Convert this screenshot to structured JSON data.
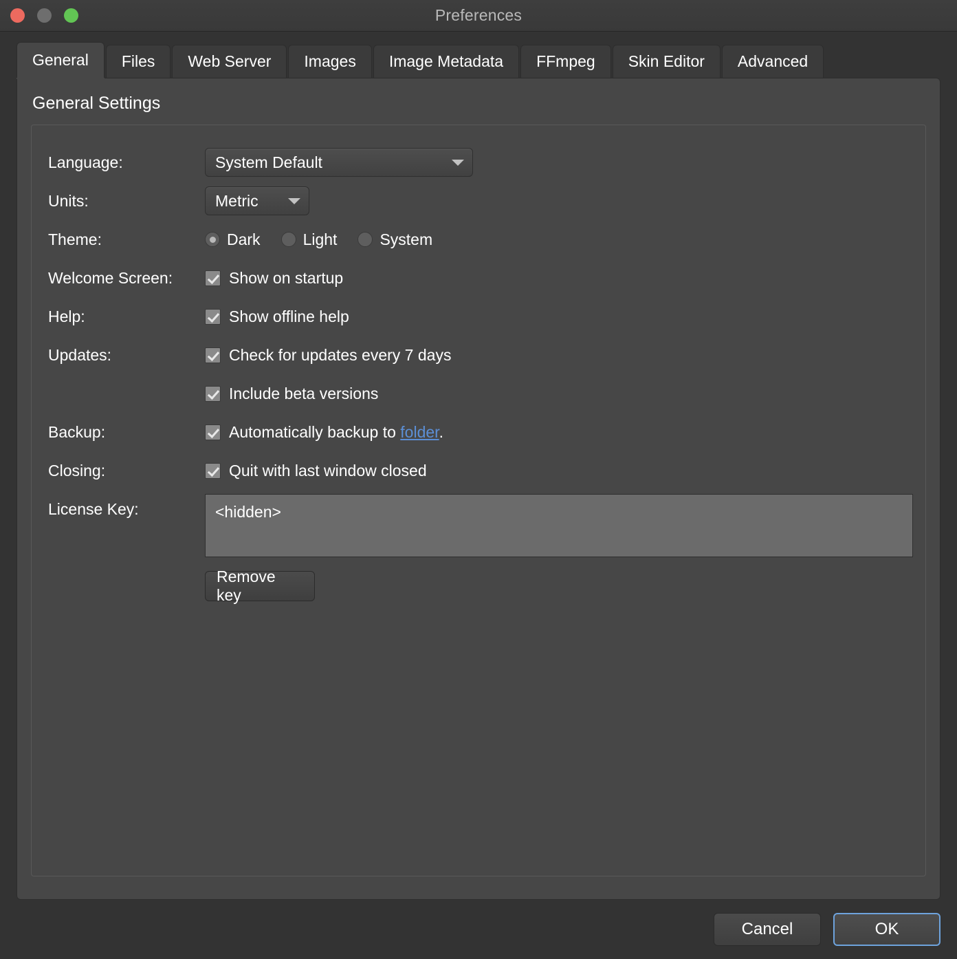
{
  "window": {
    "title": "Preferences",
    "traffic_lights": [
      {
        "name": "close",
        "color": "#ed6a5f"
      },
      {
        "name": "minimize",
        "color": "#6e6e6e"
      },
      {
        "name": "maximize",
        "color": "#62c554"
      }
    ]
  },
  "tabs": [
    {
      "label": "General",
      "active": true
    },
    {
      "label": "Files",
      "active": false
    },
    {
      "label": "Web Server",
      "active": false
    },
    {
      "label": "Images",
      "active": false
    },
    {
      "label": "Image Metadata",
      "active": false
    },
    {
      "label": "FFmpeg",
      "active": false
    },
    {
      "label": "Skin Editor",
      "active": false
    },
    {
      "label": "Advanced",
      "active": false
    }
  ],
  "general": {
    "section_title": "General Settings",
    "language": {
      "label": "Language:",
      "value": "System Default",
      "options": [
        "System Default"
      ]
    },
    "units": {
      "label": "Units:",
      "value": "Metric",
      "options": [
        "Metric"
      ]
    },
    "theme": {
      "label": "Theme:",
      "selected": "Dark",
      "options": [
        {
          "label": "Dark",
          "checked": true
        },
        {
          "label": "Light",
          "checked": false
        },
        {
          "label": "System",
          "checked": false
        }
      ]
    },
    "welcome_screen": {
      "label": "Welcome Screen:",
      "checkbox_label": "Show on startup",
      "checked": true
    },
    "help": {
      "label": "Help:",
      "checkbox_label": "Show offline help",
      "checked": true
    },
    "updates": {
      "label": "Updates:",
      "checkbox_label": "Check for updates every 7 days",
      "checked": true,
      "beta_label": "Include beta versions",
      "beta_checked": true
    },
    "backup": {
      "label": "Backup:",
      "text_before": "Automatically backup to",
      "link_text": "folder",
      "text_after": ".",
      "checked": true
    },
    "closing": {
      "label": "Closing:",
      "checkbox_label": "Quit with last window closed",
      "checked": true
    },
    "license": {
      "label": "License Key:",
      "value": "<hidden>",
      "remove_button": "Remove key"
    }
  },
  "footer": {
    "cancel": "Cancel",
    "ok": "OK"
  },
  "colors": {
    "accent": "#6ea3dd",
    "link": "#5c8fd6",
    "panel": "#474747",
    "window": "#333333"
  }
}
